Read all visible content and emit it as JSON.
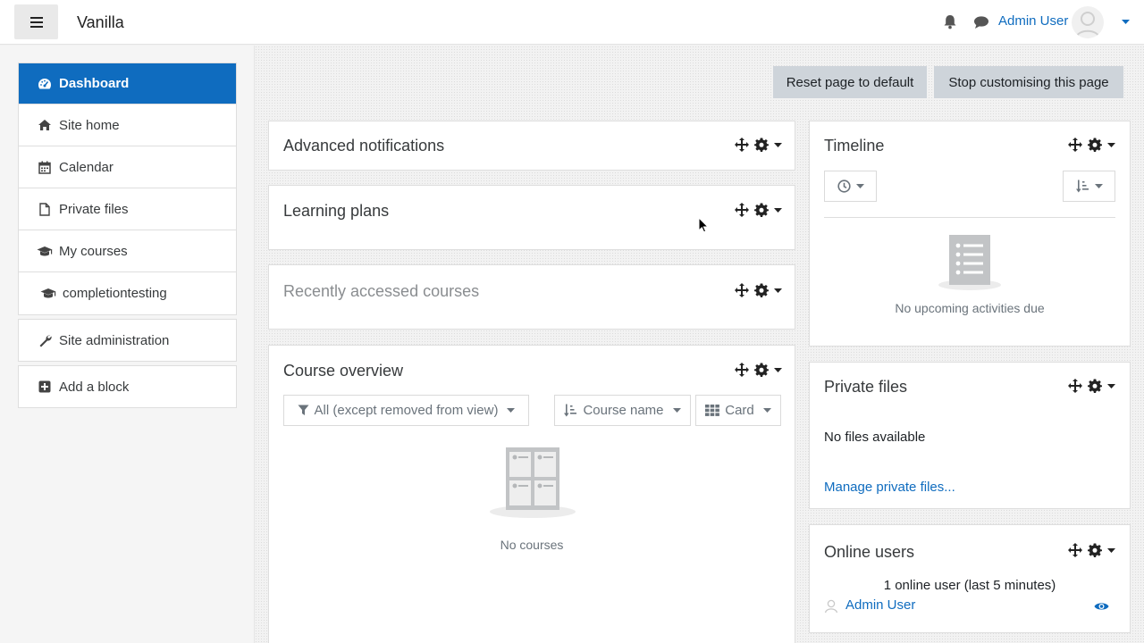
{
  "header": {
    "site_name": "Vanilla",
    "user_name": "Admin User",
    "icons": [
      "menu-icon",
      "bell-icon",
      "chat-icon",
      "avatar-icon",
      "caret-down-icon"
    ]
  },
  "nav": {
    "items": [
      {
        "label": "Dashboard",
        "icon": "dashboard-icon",
        "active": true
      },
      {
        "label": "Site home",
        "icon": "home-icon"
      },
      {
        "label": "Calendar",
        "icon": "calendar-icon"
      },
      {
        "label": "Private files",
        "icon": "file-icon"
      },
      {
        "label": "My courses",
        "icon": "graduation-cap-icon"
      },
      {
        "label": "completiontesting",
        "icon": "graduation-cap-icon"
      }
    ],
    "site_admin": "Site administration",
    "add_block": "Add a block"
  },
  "page_actions": {
    "reset": "Reset page to default",
    "stop": "Stop customising this page"
  },
  "blocks": {
    "advanced_notifications": {
      "title": "Advanced notifications"
    },
    "learning_plans": {
      "title": "Learning plans"
    },
    "recently_accessed": {
      "title": "Recently accessed courses"
    },
    "course_overview": {
      "title": "Course overview",
      "filter": "All (except removed from view)",
      "sort": "Course name",
      "view": "Card",
      "empty": "No courses"
    },
    "timeline": {
      "title": "Timeline",
      "empty": "No upcoming activities due"
    },
    "private_files": {
      "title": "Private files",
      "empty": "No files available",
      "manage": "Manage private files..."
    },
    "online_users": {
      "title": "Online users",
      "summary": "1 online user (last 5 minutes)",
      "user": "Admin User"
    }
  },
  "colors": {
    "brand": "#0f6cbf",
    "button": "#ced4da",
    "text": "#373a3c",
    "muted": "#6a737b"
  }
}
